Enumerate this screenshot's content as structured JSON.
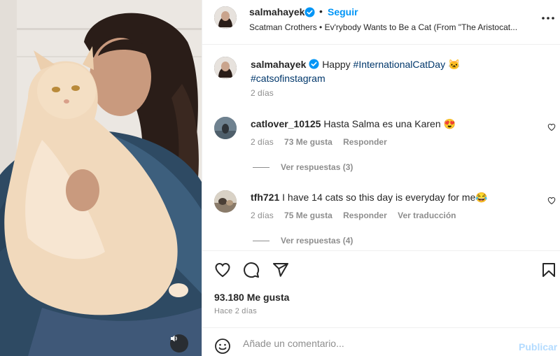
{
  "header": {
    "username": "salmahayek",
    "separator": "•",
    "follow_label": "Seguir",
    "song": "Scatman Crothers • Ev'rybody Wants to Be a Cat (From \"The Aristocat..."
  },
  "caption": {
    "username": "salmahayek",
    "text": "Happy",
    "hashtag1": "#InternationalCatDay",
    "emoji": "🐱",
    "hashtag2": "#catsofinstagram",
    "time": "2 días"
  },
  "comments": [
    {
      "username": "catlover_10125",
      "text": "Hasta Salma es una Karen 😍",
      "time": "2 días",
      "likes": "73 Me gusta",
      "reply": "Responder",
      "view_replies": "Ver respuestas (3)"
    },
    {
      "username": "tfh721",
      "text": "I have 14 cats so this day is everyday for me😂",
      "time": "2 días",
      "likes": "75 Me gusta",
      "reply": "Responder",
      "translate": "Ver traducción",
      "view_replies": "Ver respuestas (4)"
    }
  ],
  "stats": {
    "likes": "93.180 Me gusta",
    "posted": "Hace 2 días"
  },
  "composer": {
    "placeholder": "Añade un comentario...",
    "publish_label": "Publicar"
  },
  "icons": {
    "verified": "verified-badge-icon",
    "more": "more-options-icon",
    "like": "heart-icon",
    "comment": "comment-icon",
    "share": "share-icon",
    "save": "bookmark-icon",
    "emoji": "emoji-icon",
    "sound": "speaker-icon"
  },
  "colors": {
    "accent": "#0095f6",
    "hashtag": "#00376b",
    "muted": "#8e8e8e",
    "publish_disabled": "#b3dbff"
  }
}
